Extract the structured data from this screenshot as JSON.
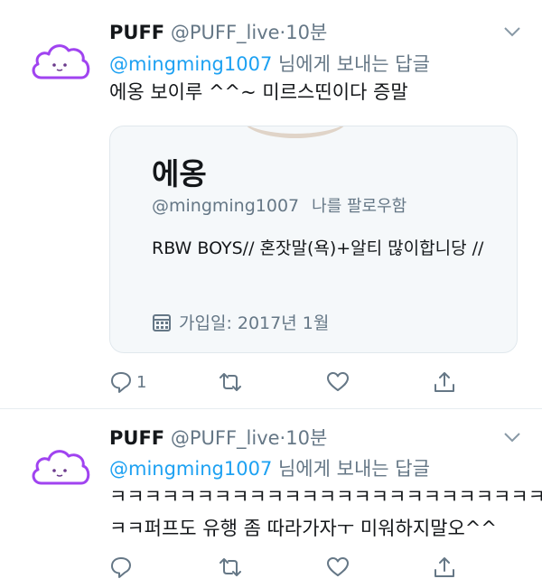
{
  "tweets": [
    {
      "name": "PUFF",
      "handle": "@PUFF_live",
      "dot": "·",
      "time": "10분",
      "reply_mention": "@mingming1007",
      "reply_suffix": " 님에게 보내는 답글",
      "text_lines": [
        "에옹 보이루 ^^~ 미르스띤이다 증말"
      ],
      "card": {
        "name": "에옹",
        "handle": "@mingming1007",
        "follows_label": "나를 팔로우함",
        "bio": "RBW BOYS// 혼잣말(욕)+알티 많이합니당 //",
        "joined": "가입일: 2017년 1월"
      },
      "reply_count": "1"
    },
    {
      "name": "PUFF",
      "handle": "@PUFF_live",
      "dot": "·",
      "time": "10분",
      "reply_mention": "@mingming1007",
      "reply_suffix": " 님에게 보내는 답글",
      "text_lines": [
        "ㅋㅋㅋㅋㅋㅋㅋㅋㅋㅋㅋㅋㅋㅋㅋㅋㅋㅋㅋㅋㅋㅋㅋㅋㅋ",
        "ㅋㅋ퍼프도 유행 좀 따라가자ㅜ 미워하지말오^^"
      ],
      "reply_count": ""
    }
  ],
  "icons": {
    "avatar": "cloud-avatar-icon",
    "caret": "chevron-down-icon",
    "reply": "reply-icon",
    "retweet": "retweet-icon",
    "like": "heart-icon",
    "share": "share-icon",
    "calendar": "calendar-icon"
  },
  "colors": {
    "mention": "#1da1f2",
    "muted": "#657786",
    "avatar_purple": "#a043f0",
    "card_bg": "#f5f8fa"
  }
}
